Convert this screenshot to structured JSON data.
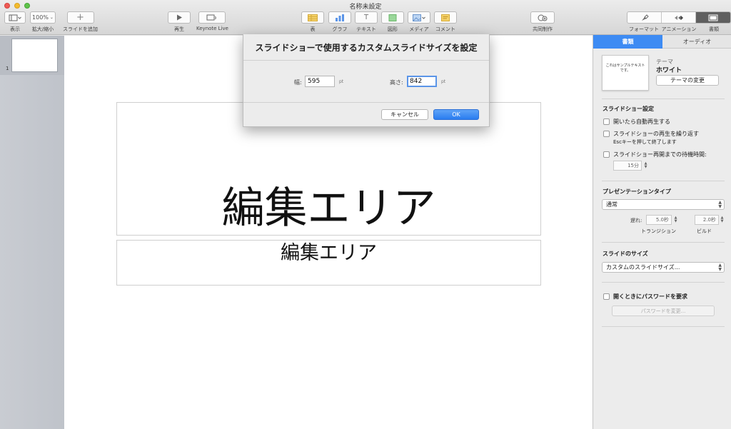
{
  "window": {
    "title": "名称未設定"
  },
  "toolbar": {
    "view_label": "表示",
    "zoom_value": "100%",
    "zoom_label": "拡大/縮小",
    "add_slide_label": "スライドを追加",
    "play_label": "再生",
    "keynote_live_label": "Keynote Live",
    "table_label": "表",
    "chart_label": "グラフ",
    "text_label": "テキスト",
    "shape_label": "図形",
    "media_label": "メディア",
    "comment_label": "コメント",
    "collaborate_label": "共同制作",
    "format_label": "フォーマット",
    "animate_label": "アニメーション",
    "document_label": "書類"
  },
  "navigator": {
    "slide_number": "1"
  },
  "slide": {
    "title": "編集エリア",
    "subtitle": "編集エリア"
  },
  "dialog": {
    "title": "スライドショーで使用するカスタムスライドサイズを設定",
    "width_label": "幅:",
    "width_value": "595",
    "height_label": "高さ:",
    "height_value": "842",
    "unit": "pt",
    "cancel_label": "キャンセル",
    "ok_label": "OK"
  },
  "inspector": {
    "tab_document": "書類",
    "tab_audio": "オーディオ",
    "theme_thumb_text": "これはサンプルテキストです。",
    "theme_label": "テーマ",
    "theme_name": "ホワイト",
    "change_theme_label": "テーマの変更",
    "slideshow_settings_title": "スライドショー設定",
    "autoplay_label": "開いたら自動再生する",
    "loop_label": "スライドショーの再生を繰り返す",
    "loop_sub": "Escキーを押して終了します",
    "idle_label": "スライドショー再開までの待機時間:",
    "idle_value": "15分",
    "presentation_type_title": "プレゼンテーションタイプ",
    "presentation_type_value": "通常",
    "delay_label": "遅れ:",
    "transition_delay": "5.0秒",
    "build_delay": "2.0秒",
    "transition_label": "トランジション",
    "build_label": "ビルド",
    "slide_size_title": "スライドのサイズ",
    "slide_size_value": "カスタムのスライドサイズ...",
    "password_label": "開くときにパスワードを要求",
    "change_password_label": "パスワードを変更..."
  }
}
